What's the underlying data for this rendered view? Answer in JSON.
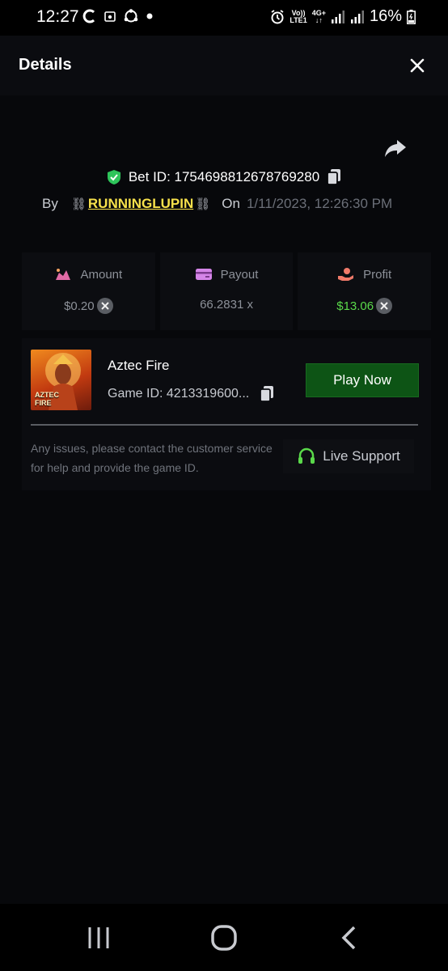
{
  "status_bar": {
    "time": "12:27",
    "battery": "16%",
    "network_top": "Vo))",
    "network_bottom": "LTE1",
    "network_type": "4G+"
  },
  "header": {
    "title": "Details"
  },
  "bet": {
    "label": "Bet ID: 1754698812678769280",
    "by_label": "By",
    "user_prefix": "⛓",
    "user": "RUNNINGLUPIN",
    "user_suffix": "⛓",
    "on_label": "On",
    "date": "1/11/2023, 12:26:30 PM"
  },
  "stats": {
    "amount_label": "Amount",
    "amount_value": "$0.20",
    "payout_label": "Payout",
    "payout_value": "66.2831 x",
    "profit_label": "Profit",
    "profit_value": "$13.06"
  },
  "game": {
    "name": "Aztec Fire",
    "id_text": "Game ID: 4213319600...",
    "thumb_title_1": "AZTEC",
    "thumb_title_2": "FIRE",
    "play_label": "Play Now"
  },
  "help": {
    "text": "Any issues, please contact the customer service for help and provide the game ID.",
    "support_label": "Live Support"
  },
  "colors": {
    "accent_green": "#5ad94a",
    "play_button": "#0d5415",
    "username": "#f7e14b"
  }
}
